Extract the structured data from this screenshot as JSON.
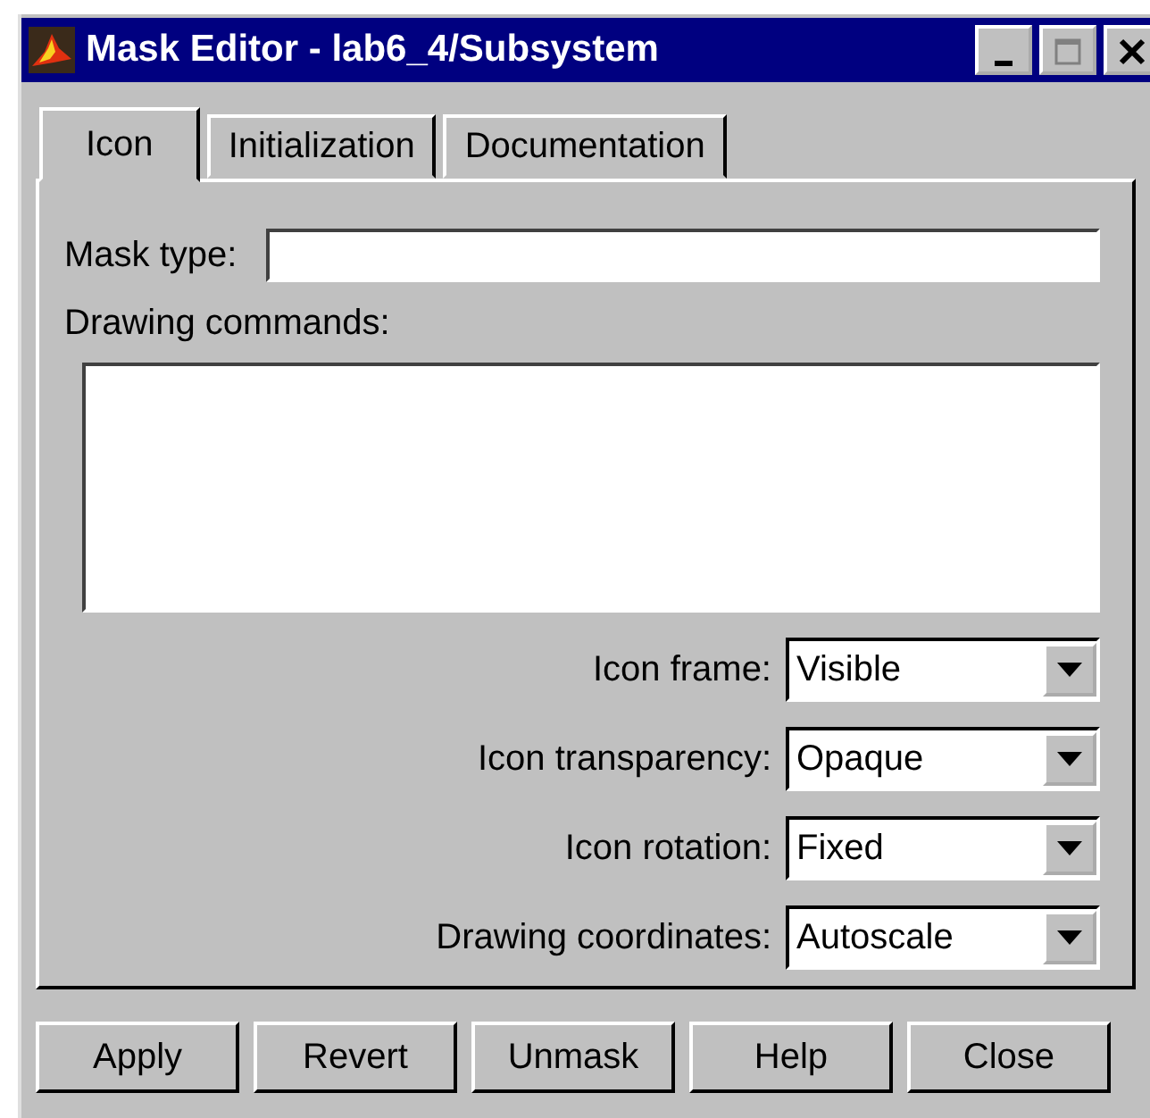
{
  "window": {
    "title": "Mask Editor - lab6_4/Subsystem"
  },
  "tabs": [
    {
      "label": "Icon",
      "selected": true
    },
    {
      "label": "Initialization",
      "selected": false
    },
    {
      "label": "Documentation",
      "selected": false
    }
  ],
  "mask_type": {
    "label": "Mask type:"
  },
  "drawing_commands": {
    "label": "Drawing commands:"
  },
  "options": [
    {
      "label": "Icon frame:",
      "value": "Visible"
    },
    {
      "label": "Icon transparency:",
      "value": "Opaque"
    },
    {
      "label": "Icon rotation:",
      "value": "Fixed"
    },
    {
      "label": "Drawing coordinates:",
      "value": "Autoscale"
    }
  ],
  "buttons": [
    "Apply",
    "Revert",
    "Unmask",
    "Help",
    "Close"
  ]
}
